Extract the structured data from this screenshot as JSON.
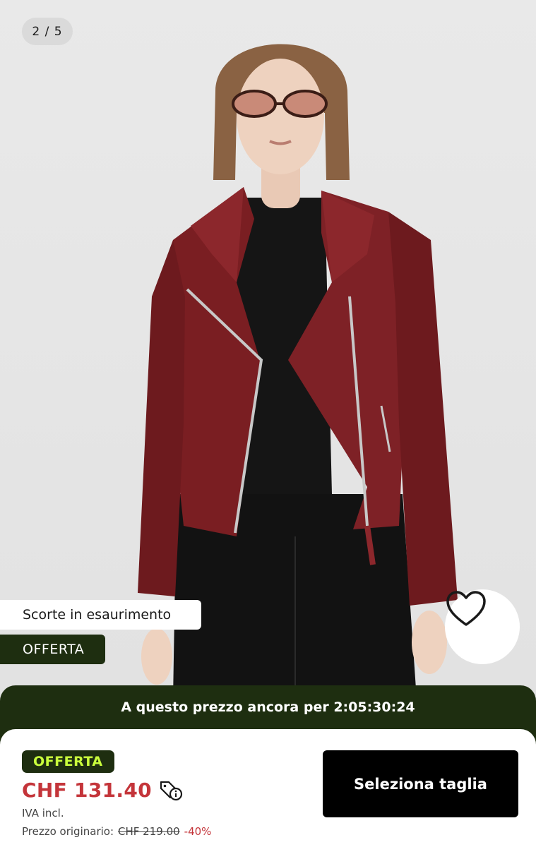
{
  "gallery": {
    "counter": "2 / 5"
  },
  "badges": {
    "stock": "Scorte in esaurimento",
    "offer": "OFFERTA"
  },
  "wishlist": {
    "icon": "heart-icon"
  },
  "countdown": {
    "label": "A questo prezzo ancora per 2:05:30:24"
  },
  "product": {
    "sale_pill": "OFFERTA",
    "price": "CHF 131.40",
    "vat": "IVA incl.",
    "original_label": "Prezzo originario:",
    "original_price": "CHF 219.00",
    "discount": "-40%"
  },
  "actions": {
    "select_size": "Seleziona taglia"
  },
  "colors": {
    "dark_green": "#1e2e10",
    "lime": "#c9ff3c",
    "sale_red": "#c4353a",
    "jacket": "#7a1e22"
  }
}
